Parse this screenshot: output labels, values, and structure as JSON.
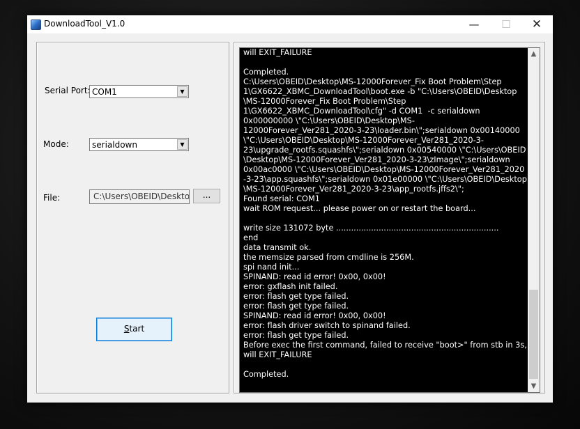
{
  "window": {
    "title": "DownloadTool_V1.0",
    "minimize_glyph": "—",
    "maximize_glyph": "☐",
    "close_glyph": "✕"
  },
  "form": {
    "serial_port_label": "Serial Port:",
    "serial_port_value": "COM1",
    "mode_label": "Mode:",
    "mode_value": "serialdown",
    "file_label": "File:",
    "file_value": "C:\\Users\\OBEID\\Desktop",
    "browse_label": "...",
    "start_label_underlined": "S",
    "start_label_rest": "tart"
  },
  "icons": {
    "app": "app-icon",
    "combo_arrow": "▼",
    "scroll_up": "▲",
    "scroll_down": "▼"
  },
  "log": {
    "lines": [
      "will EXIT_FAILURE",
      "",
      "Completed.",
      "C:\\Users\\OBEID\\Desktop\\MS-12000Forever_Fix Boot Problem\\Step",
      "1\\GX6622_XBMC_DownloadTool\\boot.exe -b \"C:\\Users\\OBEID\\Desktop",
      "\\MS-12000Forever_Fix Boot Problem\\Step",
      "1\\GX6622_XBMC_DownloadTool\\cfg\" -d COM1  -c serialdown",
      "0x00000000 \\\"C:\\Users\\OBEID\\Desktop\\MS-",
      "12000Forever_Ver281_2020-3-23\\loader.bin\\\";serialdown 0x00140000",
      "\\\"C:\\Users\\OBEID\\Desktop\\MS-12000Forever_Ver281_2020-3-",
      "23\\upgrade_rootfs.squashfs\\\";serialdown 0x00540000 \\\"C:\\Users\\OBEID",
      "\\Desktop\\MS-12000Forever_Ver281_2020-3-23\\zImage\\\";serialdown",
      "0x00ac0000 \\\"C:\\Users\\OBEID\\Desktop\\MS-12000Forever_Ver281_2020",
      "-3-23\\app.squashfs\\\";serialdown 0x01e00000 \\\"C:\\Users\\OBEID\\Desktop",
      "\\MS-12000Forever_Ver281_2020-3-23\\app_rootfs.jffs2\\\";",
      "Found serial: COM1",
      "wait ROM request... please power on or restart the board...",
      "",
      "write size 131072 byte .................................................................",
      "end",
      "data transmit ok.",
      "the memsize parsed from cmdline is 256M.",
      "spi nand init...",
      "SPINAND: read id error! 0x00, 0x00!",
      "error: gxflash init failed.",
      "error: flash get type failed.",
      "error: flash get type failed.",
      "SPINAND: read id error! 0x00, 0x00!",
      "error: flash driver switch to spinand failed.",
      "error: flash get type failed.",
      "Before exec the first command, failed to receive \"boot>\" from stb in 3s,",
      "will EXIT_FAILURE",
      "",
      "Completed."
    ]
  }
}
